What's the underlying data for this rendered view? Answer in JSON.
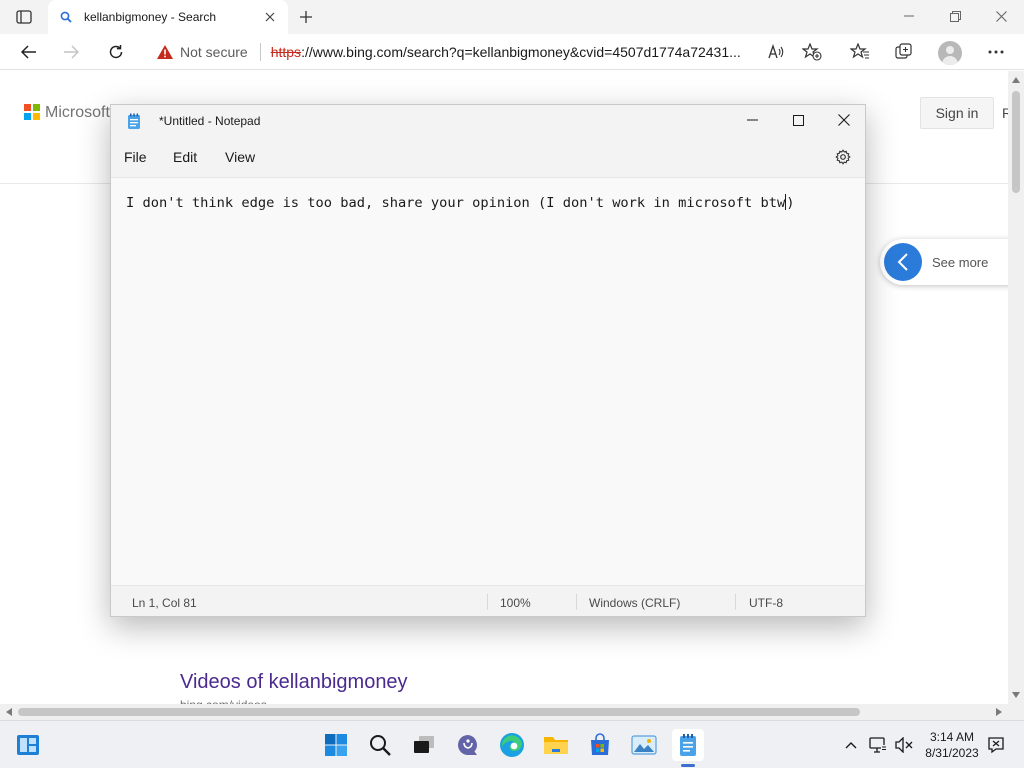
{
  "browser": {
    "tab_title": "kellanbigmoney - Search",
    "security_label": "Not secure",
    "url_protocol": "https",
    "url_rest": "://www.bing.com/search?q=kellanbigmoney&cvid=4507d1774a72431...",
    "icons": [
      "tab-actions-icon",
      "search-icon",
      "close-icon",
      "plus-icon",
      "minimize-icon",
      "restore-icon",
      "close-icon",
      "back-icon",
      "forward-icon",
      "refresh-icon",
      "warning-icon",
      "read-aloud-icon",
      "add-favorite-icon",
      "favorites-icon",
      "collections-icon",
      "profile-icon",
      "more-icon"
    ]
  },
  "bing": {
    "brand_word": "Microsoft",
    "signin_label": "Sign in",
    "right_cut_letter": "R",
    "see_more_label": "See more",
    "videos_heading": "Videos of kellanbigmoney",
    "videos_sub": "bing.com/videos"
  },
  "notepad": {
    "title": "*Untitled - Notepad",
    "menu": [
      "File",
      "Edit",
      "View"
    ],
    "text": "I don't think edge is too bad, share your opinion (I don't work in microsoft btw",
    "text_after_caret": ")",
    "status": {
      "position": "Ln 1, Col 81",
      "zoom": "100%",
      "line_ending": "Windows (CRLF)",
      "encoding": "UTF-8"
    }
  },
  "taskbar": {
    "apps": [
      "widgets-icon",
      "start-icon",
      "search-icon",
      "task-view-icon",
      "chat-icon",
      "edge-icon",
      "file-explorer-icon",
      "store-icon",
      "photos-icon",
      "notepad-icon"
    ],
    "time": "3:14 AM",
    "date": "8/31/2023"
  },
  "colors": {
    "accent": "#2b7bda",
    "link_visited": "#4b2a8f",
    "insecure_red": "#c42b1c"
  }
}
